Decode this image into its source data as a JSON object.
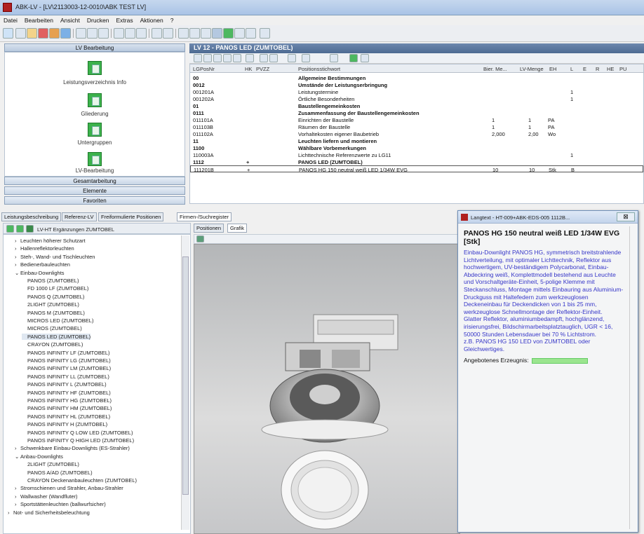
{
  "window": {
    "title": "ABK-LV - [LV\\2113003-12-0010\\ABK TEST LV]"
  },
  "menu": [
    "Datei",
    "Bearbeiten",
    "Ansicht",
    "Drucken",
    "Extras",
    "Aktionen",
    "?"
  ],
  "left_panel": {
    "header": "LV Bearbeitung",
    "icons": [
      {
        "label": "Leistungsverzeichnis Info",
        "icon": "lv-info-icon"
      },
      {
        "label": "Gliederung",
        "icon": "gliederung-icon"
      },
      {
        "label": "Untergruppen",
        "icon": "untergruppen-icon"
      },
      {
        "label": "LV-Bearbeitung",
        "icon": "lv-bearbeitung-icon"
      }
    ],
    "nav_buttons": [
      "Gesamtarbeitung",
      "Elemente",
      "Favoriten"
    ]
  },
  "grid": {
    "header": "LV 12 - PANOS LED (ZUMTOBEL)",
    "columns": [
      "LGPosNr",
      "HK",
      "PVZZ",
      "Positionsstichwort",
      "Bier. Me...",
      "LV-Menge",
      "EH",
      "L",
      "E",
      "R",
      "HE",
      "PU"
    ],
    "rows": [
      {
        "nr": "00",
        "text": "Allgemeine Bestimmungen",
        "bold": true,
        "menge": "",
        "eh": "",
        "l": ""
      },
      {
        "nr": "0012",
        "text": "Umstände der Leistungserbringung",
        "bold": true,
        "menge": "",
        "eh": "",
        "l": ""
      },
      {
        "nr": "001201A",
        "text": "Leistungstermine",
        "bold": false,
        "menge": "",
        "eh": "",
        "l": "1"
      },
      {
        "nr": "001202A",
        "text": "Örtliche Besonderheiten",
        "bold": false,
        "menge": "",
        "eh": "",
        "l": "1"
      },
      {
        "nr": "01",
        "text": "Baustellengemeinkosten",
        "bold": true,
        "menge": "",
        "eh": "",
        "l": ""
      },
      {
        "nr": "0111",
        "text": "Zusammenfassung der Baustellengemeinkosten",
        "bold": true,
        "menge": "",
        "eh": "",
        "l": ""
      },
      {
        "nr": "011101A",
        "text": "Einrichten der Baustelle",
        "bold": false,
        "bier": "1",
        "menge": "1",
        "eh": "PA",
        "l": ""
      },
      {
        "nr": "011103B",
        "text": "Räumen der Baustelle",
        "bold": false,
        "bier": "1",
        "menge": "1",
        "eh": "PA",
        "l": ""
      },
      {
        "nr": "011102A",
        "text": "Vorhaltekosten eigener Baubetrieb",
        "bold": false,
        "bier": "2,000",
        "menge": "2,00",
        "eh": "Wo",
        "l": ""
      },
      {
        "nr": "11",
        "text": "Leuchten liefern und montieren",
        "bold": true,
        "menge": "",
        "eh": "",
        "l": ""
      },
      {
        "nr": "1100",
        "text": "Wählbare Vorbemerkungen",
        "bold": true,
        "menge": "",
        "eh": "",
        "l": ""
      },
      {
        "nr": "110003A",
        "text": "Lichttechnische Referenzwerte zu LG11",
        "bold": false,
        "menge": "",
        "eh": "",
        "l": "1"
      },
      {
        "nr": "1112",
        "hk": "+",
        "text": "PANOS LED (ZUMTOBEL)",
        "bold": true,
        "menge": "",
        "eh": "",
        "l": ""
      },
      {
        "nr": "111201B",
        "hk": "+",
        "text": "PANOS HG 150 neutral weiß LED 1/34W EVG",
        "bold": false,
        "bier": "10",
        "menge": "10",
        "eh": "Stk",
        "l": "B",
        "sel": true
      }
    ]
  },
  "lower_tabs": [
    "Leistungsbeschreibung",
    "Referenz-LV",
    "Freiformulierte Positionen",
    "Firmen-/Suchregister"
  ],
  "tree": {
    "root": "LV-HT Ergänzungen ZUMTOBEL",
    "items": [
      {
        "t": "Leuchten höherer Schutzart",
        "lvl": 1,
        "exp": "›"
      },
      {
        "t": "Hallenreflektorleuchten",
        "lvl": 1,
        "exp": "›"
      },
      {
        "t": "Steh-, Wand- und Tischleuchten",
        "lvl": 1,
        "exp": "›"
      },
      {
        "t": "Bedienerbauleuchten",
        "lvl": 1,
        "exp": "›"
      },
      {
        "t": "Einbau-Downlights",
        "lvl": 1,
        "exp": "⌄"
      },
      {
        "t": "PANOS (ZUMTOBEL)",
        "lvl": 2
      },
      {
        "t": "FD 1000 LF (ZUMTOBEL)",
        "lvl": 2
      },
      {
        "t": "PANOS Q (ZUMTOBEL)",
        "lvl": 2
      },
      {
        "t": "2LIGHT (ZUMTOBEL)",
        "lvl": 2
      },
      {
        "t": "PANOS M (ZUMTOBEL)",
        "lvl": 2
      },
      {
        "t": "MICROS LED (ZUMTOBEL)",
        "lvl": 2
      },
      {
        "t": "MICROS (ZUMTOBEL)",
        "lvl": 2
      },
      {
        "t": "PANOS LED (ZUMTOBEL)",
        "lvl": 2,
        "sel": true
      },
      {
        "t": "CRAYON (ZUMTOBEL)",
        "lvl": 2
      },
      {
        "t": "PANOS INFINITY LF (ZUMTOBEL)",
        "lvl": 2
      },
      {
        "t": "PANOS INFINITY LG (ZUMTOBEL)",
        "lvl": 2
      },
      {
        "t": "PANOS INFINITY LM (ZUMTOBEL)",
        "lvl": 2
      },
      {
        "t": "PANOS INFINITY LL (ZUMTOBEL)",
        "lvl": 2
      },
      {
        "t": "PANOS INFINITY L (ZUMTOBEL)",
        "lvl": 2
      },
      {
        "t": "PANOS INFINITY HF (ZUMTOBEL)",
        "lvl": 2
      },
      {
        "t": "PANOS INFINITY HG (ZUMTOBEL)",
        "lvl": 2
      },
      {
        "t": "PANOS INFINITY HM (ZUMTOBEL)",
        "lvl": 2
      },
      {
        "t": "PANOS INFINITY HL (ZUMTOBEL)",
        "lvl": 2
      },
      {
        "t": "PANOS INFINITY H (ZUMTOBEL)",
        "lvl": 2
      },
      {
        "t": "PANOS INFINITY Q LOW LED (ZUMTOBEL)",
        "lvl": 2
      },
      {
        "t": "PANOS INFINITY Q HIGH LED (ZUMTOBEL)",
        "lvl": 2
      },
      {
        "t": "Schwenkbare Einbau-Downlights (ES-Strahler)",
        "lvl": 1,
        "exp": "›"
      },
      {
        "t": "Anbau-Downlights",
        "lvl": 1,
        "exp": "⌄"
      },
      {
        "t": "2LIGHT (ZUMTOBEL)",
        "lvl": 2
      },
      {
        "t": "PANOS A/AD (ZUMTOBEL)",
        "lvl": 2
      },
      {
        "t": "CRAYON Deckenanbauleuchten (ZUMTOBEL)",
        "lvl": 2
      },
      {
        "t": "Stromschienen und Strahler, Anbau-Strahler",
        "lvl": 1,
        "exp": "›"
      },
      {
        "t": "Wallwasher (Wandfluter)",
        "lvl": 1,
        "exp": "›"
      },
      {
        "t": "Sportstättenleuchten (ballwurfsicher)",
        "lvl": 1,
        "exp": "›"
      },
      {
        "t": "Not- und Sicherheitsbeleuchtung",
        "lvl": 0,
        "exp": "›"
      }
    ]
  },
  "graph_tabs": [
    "Positionen",
    "Grafik"
  ],
  "popup": {
    "title": "Langtext - HT-009+ABK-EDS-005 1112B...",
    "close_label": "⊠",
    "heading": "PANOS HG 150 neutral weiß LED 1/34W EVG [Stk]",
    "text": "Einbau-Downlight PANOS HG, symmetrisch breitstrahlende Lichtverteilung, mit optimaler Lichttechnik, Reflektor aus hochwertigem, UV-beständigem Polycarbonat, Einbau-Abdeckring weiß, Komplettmodell bestehend aus Leuchte und Vorschaltgeräte-Einheit, 5-polige Klemme mit Steckanschluss, Montage mittels Einbauring aus Aluminium-Druckguss mit Haltefedern zum werkzeuglosen Deckeneinbau für Deckendicken von 1 bis 25 mm, werkzeuglose Schnellmontage der Reflektor-Einheit.\nGlatter Reflektor, aluminiumbedampft, hochglänzend, irisierungsfrei, Bildschirmarbeitsplatztauglich, UGR < 16, 50000 Stunden Lebensdauer bei 70 % Lichtstrom.\nz.B. PANOS HG 150 LED von ZUMTOBEL oder Gleichwertiges.",
    "offer_label": "Angebotenes Erzeugnis:"
  },
  "colors": {
    "accent": "#4d6a92",
    "popup_text": "#3636c8",
    "icon_green": "#3cb24b"
  }
}
